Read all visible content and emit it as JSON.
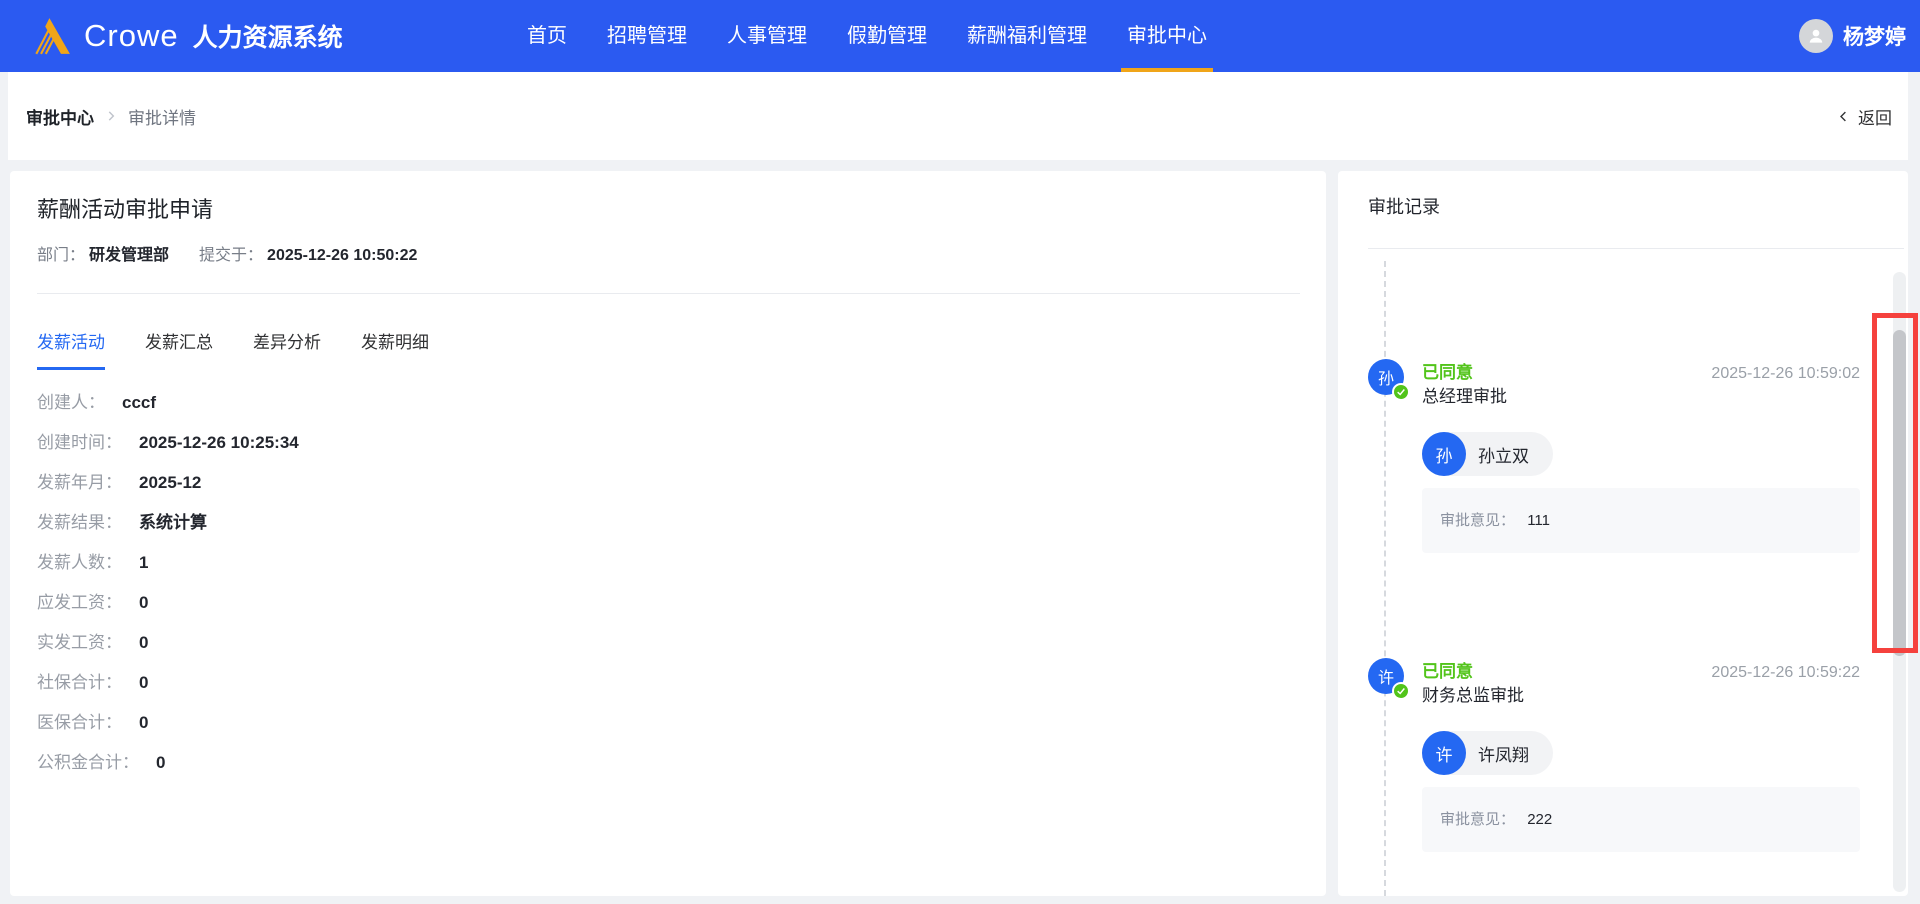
{
  "navbar": {
    "brand": {
      "name": "Crowe",
      "system": "人力资源系统"
    },
    "items": [
      "首页",
      "招聘管理",
      "人事管理",
      "假勤管理",
      "薪酬福利管理",
      "审批中心"
    ],
    "active_item": "审批中心",
    "user": {
      "name": "杨梦婷"
    }
  },
  "breadcrumb": {
    "root": "审批中心",
    "current": "审批详情",
    "back_label": "返回"
  },
  "detail": {
    "title": "薪酬活动审批申请",
    "meta": [
      {
        "label": "部门：",
        "value": "研发管理部"
      },
      {
        "label": "提交于：",
        "value": "2025-12-26 10:50:22"
      }
    ],
    "tabs": [
      "发薪活动",
      "发薪汇总",
      "差异分析",
      "发薪明细"
    ],
    "active_tab": "发薪活动",
    "fields": [
      {
        "label": "创建人：",
        "value": "cccf"
      },
      {
        "label": "创建时间：",
        "value": "2025-12-26 10:25:34"
      },
      {
        "label": "发薪年月：",
        "value": "2025-12"
      },
      {
        "label": "发薪结果：",
        "value": "系统计算"
      },
      {
        "label": "发薪人数：",
        "value": "1"
      },
      {
        "label": "应发工资：",
        "value": "0"
      },
      {
        "label": "实发工资：",
        "value": "0"
      },
      {
        "label": "社保合计：",
        "value": "0"
      },
      {
        "label": "医保合计：",
        "value": "0"
      },
      {
        "label": "公积金合计：",
        "value": "0"
      }
    ]
  },
  "approval": {
    "title": "审批记录",
    "records": [
      {
        "avatar_char": "孙",
        "status": "已同意",
        "step": "总经理审批",
        "time": "2025-12-26 10:59:02",
        "approver_char": "孙",
        "approver": "孙立双",
        "comment_label": "审批意见：",
        "comment": "111"
      },
      {
        "avatar_char": "许",
        "status": "已同意",
        "step": "财务总监审批",
        "time": "2025-12-26 10:59:22",
        "approver_char": "许",
        "approver": "许凤翔",
        "comment_label": "审批意见：",
        "comment": "222"
      }
    ]
  },
  "icons": {
    "logo": "crowe-triangle-icon",
    "user": "user-avatar-icon",
    "breadcrumb_separator": "chevron-right-icon",
    "back": "chevron-left-icon",
    "approved_badge": "check-icon"
  },
  "colors": {
    "navbar_blue": "#2b5af1",
    "accent_yellow": "#f0a519",
    "avatar_blue": "#2468f2",
    "success_green": "#52c41a",
    "annotation_red": "#f5413d",
    "page_background": "#f0f2f5"
  }
}
